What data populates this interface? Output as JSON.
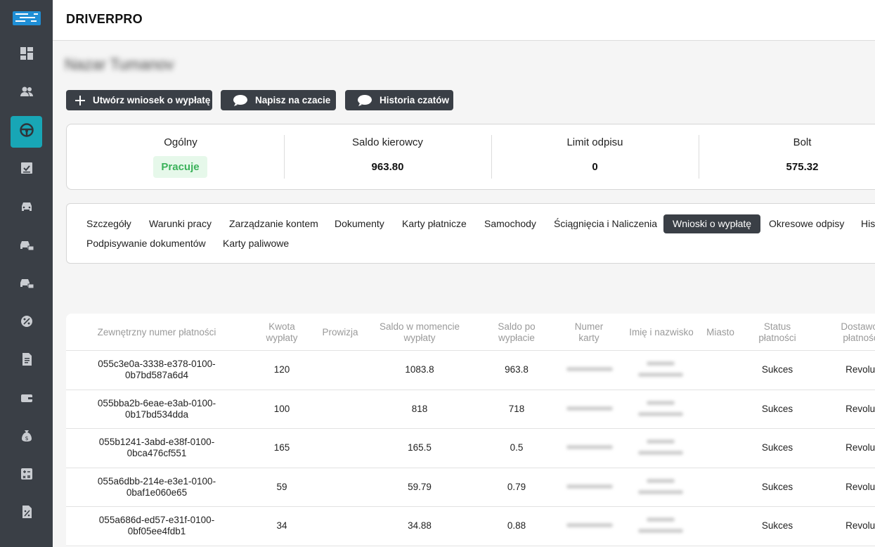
{
  "app": {
    "brand": "DRIVERPRO"
  },
  "driver": {
    "name": "Nazar Tumanov"
  },
  "sidebar": {
    "items": [
      {
        "icon": "dashboard-icon"
      },
      {
        "icon": "users-icon"
      },
      {
        "icon": "steering-wheel-icon",
        "active": true
      },
      {
        "icon": "task-check-icon"
      },
      {
        "icon": "car-icon"
      },
      {
        "icon": "car-money-icon"
      },
      {
        "icon": "car-money-icon"
      },
      {
        "icon": "percent-gear-icon"
      },
      {
        "icon": "invoice-icon"
      },
      {
        "icon": "wallet-icon"
      },
      {
        "icon": "money-bag-icon"
      },
      {
        "icon": "calculator-icon"
      },
      {
        "icon": "percent-document-icon"
      }
    ],
    "accent": "#18a6b6"
  },
  "actions": {
    "create_payout": "Utwórz wniosek o wypłatę",
    "write_chat": "Napisz na czacie",
    "chat_history": "Historia czatów"
  },
  "stats": {
    "general": {
      "label": "Ogólny",
      "value": "Pracuje"
    },
    "balance": {
      "label": "Saldo kierowcy",
      "value": "963.80"
    },
    "limit": {
      "label": "Limit odpisu",
      "value": "0"
    },
    "bolt": {
      "label": "Bolt",
      "value": "575.32"
    }
  },
  "tabs": [
    "Szczegóły",
    "Warunki pracy",
    "Zarządzanie kontem",
    "Dokumenty",
    "Karty płatnicze",
    "Samochody",
    "Ściągnięcia i Naliczenia",
    "Wnioski o wypłatę",
    "Okresowe odpisy",
    "His",
    "Podpisywanie dokumentów",
    "Karty paliwowe"
  ],
  "active_tab": "Wnioski o wypłatę",
  "table": {
    "headers": {
      "ext_id": "Zewnętrzny numer płatności",
      "amount": "Kwota wypłaty",
      "commission": "Prowizja",
      "balance_at": "Saldo w momencie wypłaty",
      "balance_after": "Saldo po wypłacie",
      "card": "Numer karty",
      "name": "Imię i nazwisko",
      "city": "Miasto",
      "status": "Status płatności",
      "provider": "Dostawca płatności"
    },
    "rows": [
      {
        "ext_id": "055c3e0a-3338-e378-0100-0b7bd587a6d4",
        "amount": "120",
        "commission": "",
        "balance_at": "1083.8",
        "balance_after": "963.8",
        "status": "Sukces",
        "provider": "Revolut"
      },
      {
        "ext_id": "055bba2b-6eae-e3ab-0100-0b17bd534dda",
        "amount": "100",
        "commission": "",
        "balance_at": "818",
        "balance_after": "718",
        "status": "Sukces",
        "provider": "Revolut"
      },
      {
        "ext_id": "055b1241-3abd-e38f-0100-0bca476cf551",
        "amount": "165",
        "commission": "",
        "balance_at": "165.5",
        "balance_after": "0.5",
        "status": "Sukces",
        "provider": "Revolut"
      },
      {
        "ext_id": "055a6dbb-214e-e3e1-0100-0baf1e060e65",
        "amount": "59",
        "commission": "",
        "balance_at": "59.79",
        "balance_after": "0.79",
        "status": "Sukces",
        "provider": "Revolut"
      },
      {
        "ext_id": "055a686d-ed57-e31f-0100-0bf05ee4fdb1",
        "amount": "34",
        "commission": "",
        "balance_at": "34.88",
        "balance_after": "0.88",
        "status": "Sukces",
        "provider": "Revolut"
      }
    ]
  }
}
